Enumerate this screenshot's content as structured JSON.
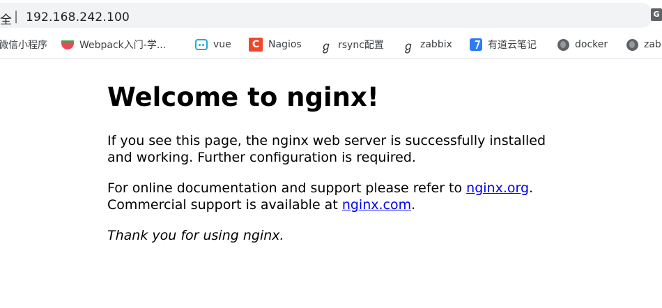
{
  "address_bar": {
    "security_text": "全",
    "separator": "|",
    "url": "192.168.242.100",
    "translate_icon": "translate-icon"
  },
  "bookmarks": [
    {
      "label": "微信小程序",
      "icon": "none"
    },
    {
      "label": "Webpack入门-学...",
      "icon": "watermelon-icon"
    },
    {
      "label": "vue",
      "icon": "bilibili-tv-icon"
    },
    {
      "label": "Nagios",
      "icon": "nagios-c-icon"
    },
    {
      "label": "rsync配置",
      "icon": "script-glyph-icon"
    },
    {
      "label": "zabbix",
      "icon": "script-glyph-icon"
    },
    {
      "label": "有道云笔记",
      "icon": "youdao-note-icon"
    },
    {
      "label": "docker",
      "icon": "globe-icon"
    },
    {
      "label": "zab",
      "icon": "globe-icon"
    }
  ],
  "page": {
    "heading": "Welcome to nginx!",
    "para1": "If you see this page, the nginx web server is successfully installed and working. Further configuration is required.",
    "para2_prefix": "For online documentation and support please refer to ",
    "link1": "nginx.org",
    "para2_mid": ".",
    "para2_line2_prefix": "Commercial support is available at ",
    "link2": "nginx.com",
    "para2_end": ".",
    "thanks": "Thank you for using nginx."
  },
  "colors": {
    "link": "#0000ee",
    "address_bar_bg": "#f1f3f4"
  }
}
